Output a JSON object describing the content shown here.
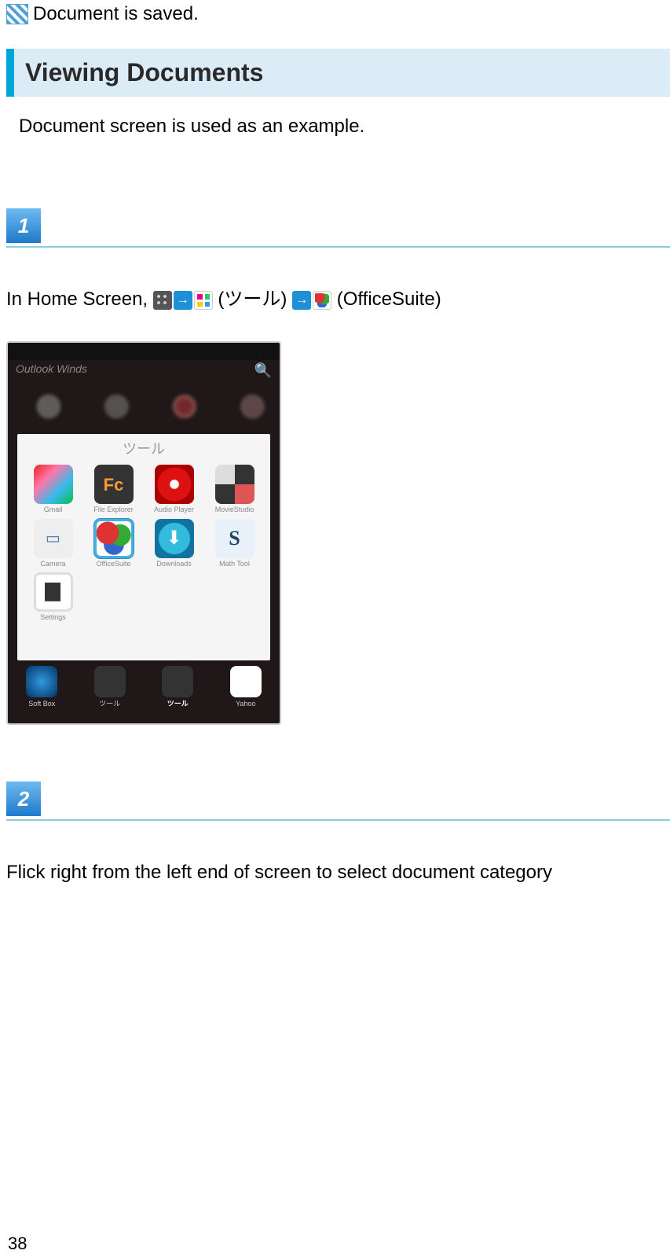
{
  "top": {
    "saved_message": "Document is saved."
  },
  "section": {
    "heading": "Viewing Documents",
    "note": "Document screen is used as an example."
  },
  "step1": {
    "number": "1",
    "text_prefix": "In Home Screen, ",
    "text_mid": " (ツール)",
    "text_suffix": " (OfficeSuite)",
    "phone": {
      "header": "Outlook Winds",
      "popup_title": "ツール",
      "apps": [
        {
          "label": "Gmail"
        },
        {
          "label": "File Explorer"
        },
        {
          "label": "Audio Player"
        },
        {
          "label": "MovieStudio"
        },
        {
          "label": "Camera"
        },
        {
          "label": "OfficeSuite"
        },
        {
          "label": "Downloads"
        },
        {
          "label": "Math Tool"
        },
        {
          "label": "Settings"
        }
      ],
      "dock": [
        {
          "label": "Soft Box"
        },
        {
          "label": "ツール"
        },
        {
          "label": "ツール"
        },
        {
          "label": "Yahoo"
        }
      ]
    }
  },
  "step2": {
    "number": "2",
    "text": "Flick right from the left end of screen to select document category"
  },
  "page_number": "38"
}
